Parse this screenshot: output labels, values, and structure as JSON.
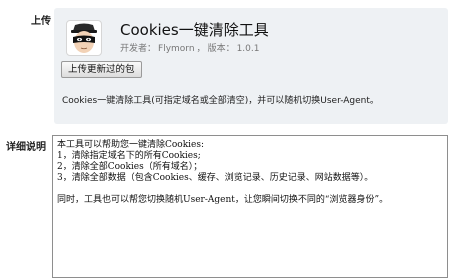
{
  "labels": {
    "upload_section": "上传",
    "detail_section": "详细说明"
  },
  "extension": {
    "icon": "masked-bandit-icon",
    "name": "Cookies一键清除工具",
    "developer_label": "开发者：",
    "developer": "Flymorn",
    "version_label": "版本：",
    "version": "1.0.1",
    "upload_button_label": "上传更新过的包",
    "summary": "Cookies一键清除工具(可指定域名或全部清空)，并可以随机切换User-Agent。"
  },
  "description": {
    "lines": [
      "本工具可以帮助您一键清除Cookies:",
      "1，清除指定域名下的所有Cookies;",
      "2，清除全部Cookies（所有域名）；",
      "3，清除全部数据（包含Cookies、缓存、浏览记录、历史记录、网站数据等）。",
      "",
      "同时，工具也可以帮您切换随机User-Agent，让您瞬间切换不同的“浏览器身份”。"
    ]
  }
}
